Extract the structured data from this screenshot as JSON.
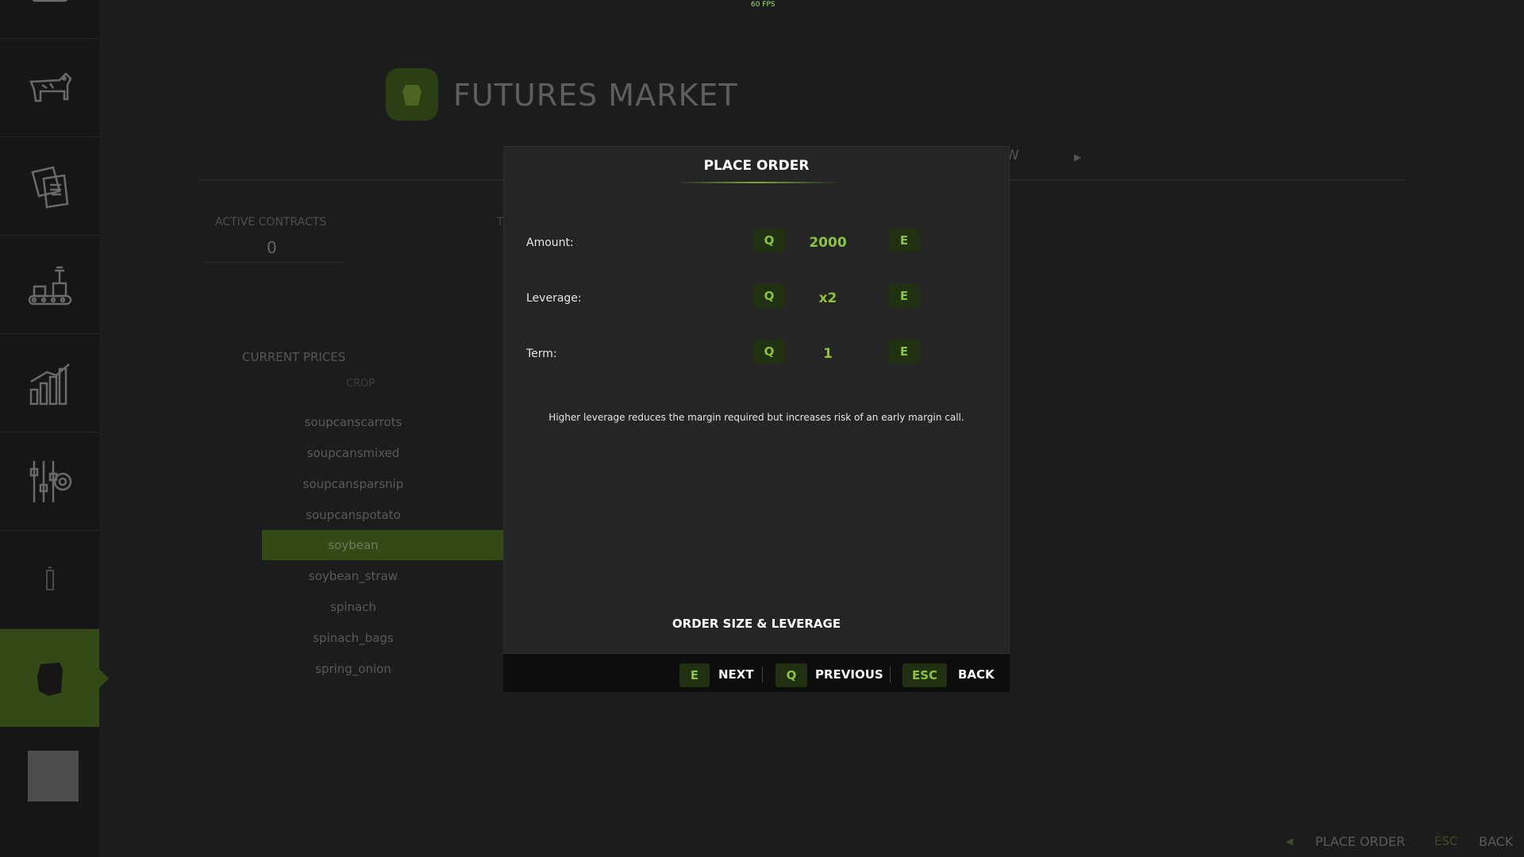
{
  "overlay": {
    "fps": "60 FPS"
  },
  "sidebar": {
    "items": [
      {
        "icon": "tractor-icon"
      },
      {
        "icon": "cow-icon"
      },
      {
        "icon": "contracts-icon"
      },
      {
        "icon": "production-icon"
      },
      {
        "icon": "statistics-icon"
      },
      {
        "icon": "settings-icon"
      },
      {
        "icon": "help-icon"
      },
      {
        "icon": "futures-market-icon",
        "active": true
      }
    ]
  },
  "page": {
    "title": "FUTURES MARKET",
    "tab_fragment": "W",
    "active_contracts_label": "ACTIVE CONTRACTS",
    "active_contracts_value": "0",
    "t_fragment": "T",
    "current_prices_label": "CURRENT PRICES",
    "crop_header": "CROP",
    "crops": [
      "soupcanscarrots",
      "soupcansmixed",
      "soupcansparsnip",
      "soupcanspotato",
      "soybean",
      "soybean_straw",
      "spinach",
      "spinach_bags",
      "spring_onion"
    ],
    "selected_crop": "soybean"
  },
  "modal": {
    "title": "PLACE ORDER",
    "rows": [
      {
        "label": "Amount:",
        "dec_key": "Q",
        "value": "2000",
        "inc_key": "E"
      },
      {
        "label": "Leverage:",
        "dec_key": "Q",
        "value": "x2",
        "inc_key": "E"
      },
      {
        "label": "Term:",
        "dec_key": "Q",
        "value": "1",
        "inc_key": "E"
      }
    ],
    "hint": "Higher leverage reduces the margin required but increases risk of an early margin call.",
    "section_label": "ORDER SIZE & LEVERAGE"
  },
  "footer": {
    "next_key": "E",
    "next_label": "NEXT",
    "prev_key": "Q",
    "prev_label": "PREVIOUS",
    "back_key": "ESC",
    "back_label": "BACK"
  },
  "bottom_bar": {
    "place_order": "PLACE ORDER",
    "esc_key": "ESC",
    "back": "BACK"
  },
  "colors": {
    "accent": "#8ac43a",
    "key_bg": "#203010",
    "active_green": "#334a17"
  }
}
